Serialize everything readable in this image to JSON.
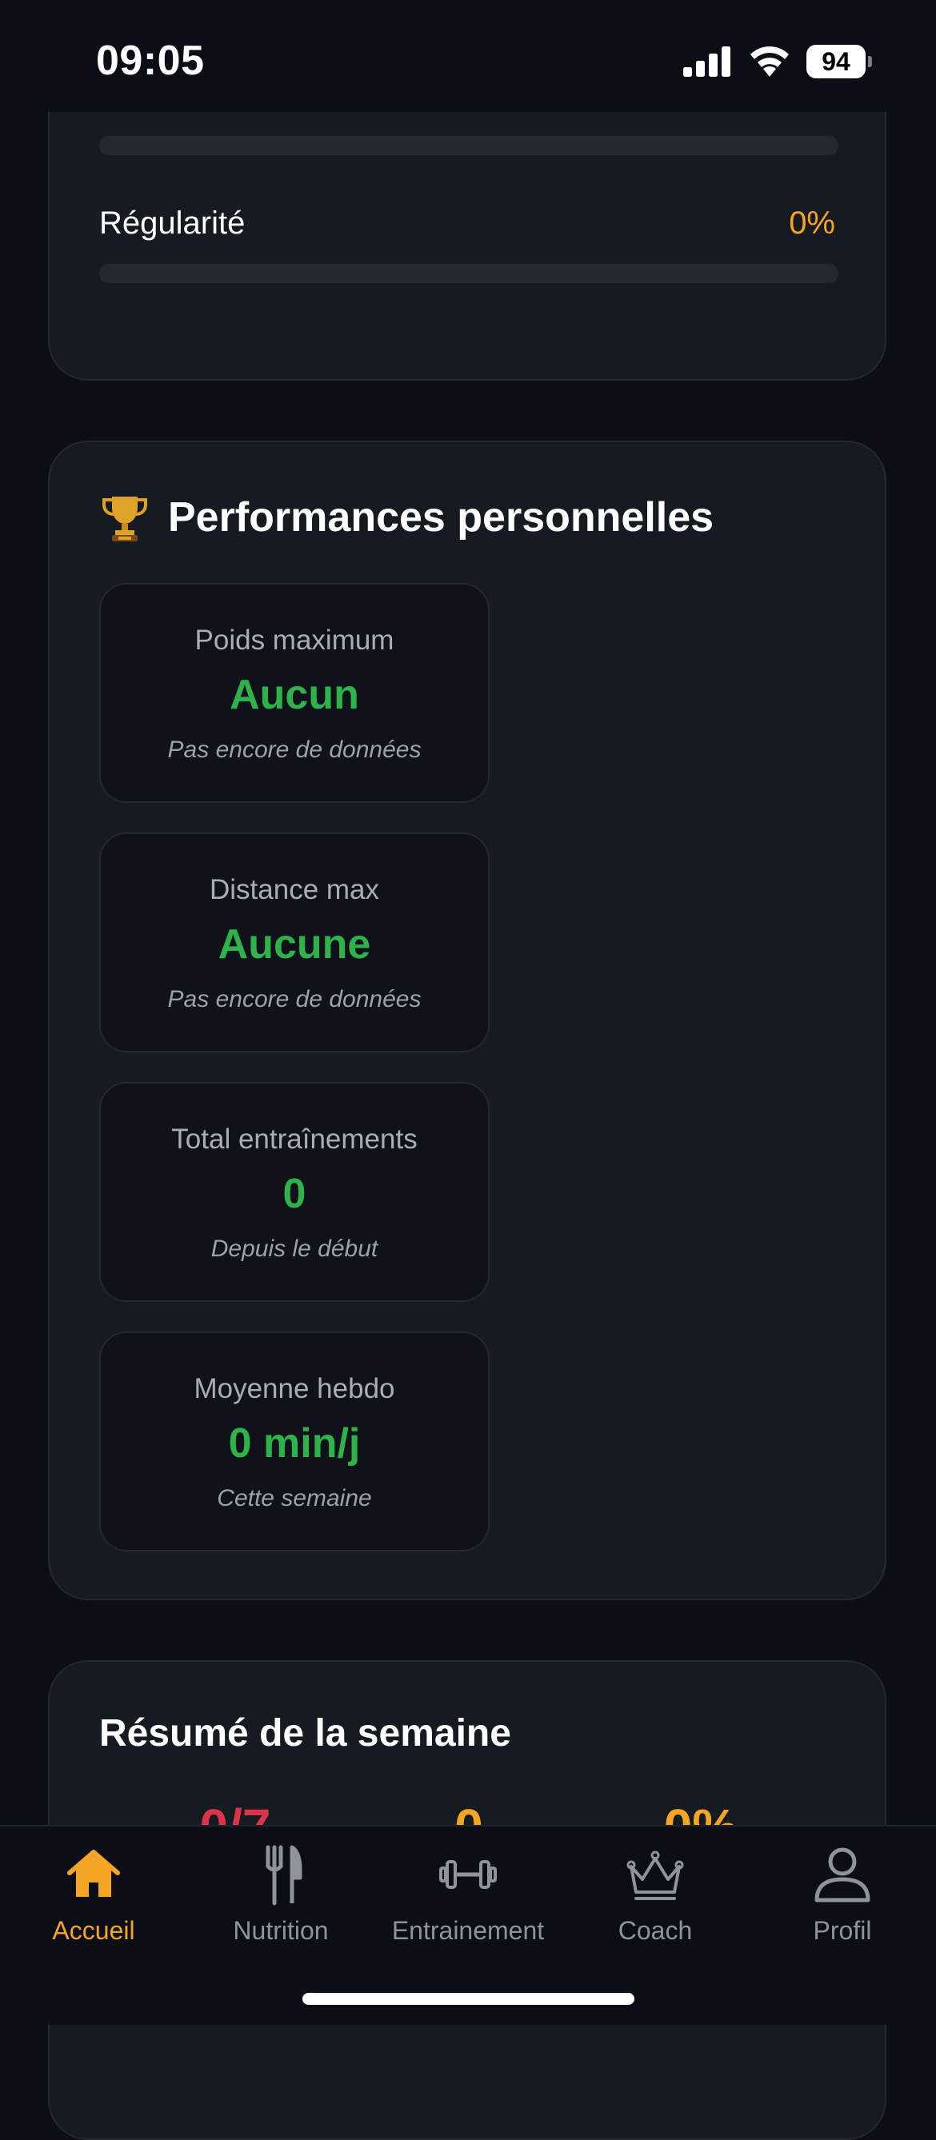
{
  "status_bar": {
    "time": "09:05",
    "battery": "94"
  },
  "progress_card": {
    "items": [
      {
        "label": "",
        "value": "",
        "progress": 0
      },
      {
        "label": "Régularité",
        "value": "0%",
        "progress": 0
      }
    ]
  },
  "performance_card": {
    "icon": "trophy-icon",
    "title": "Performances personnelles",
    "stats": [
      {
        "label": "Poids maximum",
        "value": "Aucun",
        "sub": "Pas encore de données"
      },
      {
        "label": "Distance max",
        "value": "Aucune",
        "sub": "Pas encore de données"
      },
      {
        "label": "Total entraînements",
        "value": "0",
        "sub": "Depuis le début"
      },
      {
        "label": "Moyenne hebdo",
        "value": "0 min/j",
        "sub": "Cette semaine"
      }
    ]
  },
  "resume_card": {
    "title": "Résumé de la semaine",
    "stats": [
      {
        "value": "0/7",
        "color": "#d9344a"
      },
      {
        "value": "0",
        "color": "#f5a524"
      },
      {
        "value": "0%",
        "color": "#f5a524"
      }
    ]
  },
  "tab_bar": {
    "active": "Accueil",
    "accent": "#f5a524",
    "tabs": [
      {
        "label": "Accueil",
        "icon": "home-icon"
      },
      {
        "label": "Nutrition",
        "icon": "fork-knife-icon"
      },
      {
        "label": "Entrainement",
        "icon": "dumbbell-icon"
      },
      {
        "label": "Coach",
        "icon": "crown-icon"
      },
      {
        "label": "Profil",
        "icon": "person-icon"
      }
    ]
  }
}
